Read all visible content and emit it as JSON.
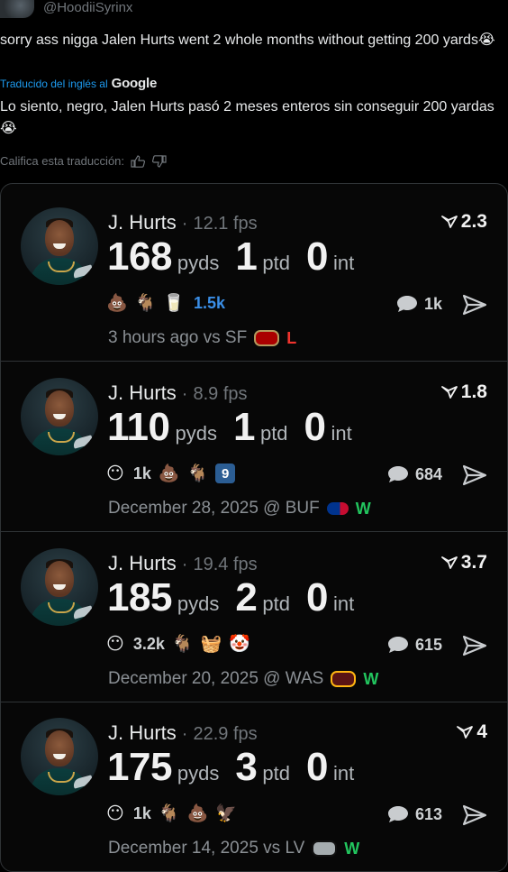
{
  "header": {
    "handle": "@HoodiiSyrinx"
  },
  "tweet": {
    "original_text": "sorry ass nigga Jalen Hurts went 2 whole months without getting 200 yards😭",
    "translated_by_label": "Traducido del inglés al",
    "translated_by_brand": "Google",
    "translated_text": "Lo siento, negro, Jalen Hurts pasó 2 meses enteros sin conseguir 200 yardas 😭",
    "rate_label": "Califica esta traducción:"
  },
  "rows": [
    {
      "name": "J. Hurts",
      "fps": "12.1 fps",
      "rating": "2.3",
      "pyds": "168",
      "ptd": "1",
      "int": "0",
      "reactions": [
        "💩",
        "🐐",
        "🥛"
      ],
      "reaction_count": "1.5k",
      "comments": "1k",
      "date": "3 hours ago vs SF",
      "team_color": "#aa0000",
      "result": "L"
    },
    {
      "name": "J. Hurts",
      "fps": "8.9 fps",
      "rating": "1.8",
      "pyds": "110",
      "ptd": "1",
      "int": "0",
      "reaction_lead": "😶",
      "reaction_count": "1k",
      "reactions": [
        "💩",
        "🐐"
      ],
      "badge": "9",
      "comments": "684",
      "date": "December 28, 2025 @ BUF",
      "team_color": "#00338d",
      "result": "W"
    },
    {
      "name": "J. Hurts",
      "fps": "19.4 fps",
      "rating": "3.7",
      "pyds": "185",
      "ptd": "2",
      "int": "0",
      "reaction_lead": "😶",
      "reaction_count": "3.2k",
      "reactions": [
        "🐐",
        "🧺",
        "🤡"
      ],
      "comments": "615",
      "date": "December 20, 2025 @ WAS",
      "team_color": "#ffb612",
      "result": "W"
    },
    {
      "name": "J. Hurts",
      "fps": "22.9 fps",
      "rating": "4",
      "pyds": "175",
      "ptd": "3",
      "int": "0",
      "reaction_lead": "😶",
      "reaction_count": "1k",
      "reactions": [
        "🐐",
        "💩",
        "🦅"
      ],
      "comments": "613",
      "date": "December 14, 2025 vs LV",
      "team_color": "#a5acaf",
      "result": "W"
    }
  ],
  "units": {
    "pyds": "pyds",
    "ptd": "ptd",
    "int": "int"
  },
  "colors": {
    "accent_blue": "#1d9bf0",
    "loss": "#f0332d",
    "win": "#22c55e"
  }
}
